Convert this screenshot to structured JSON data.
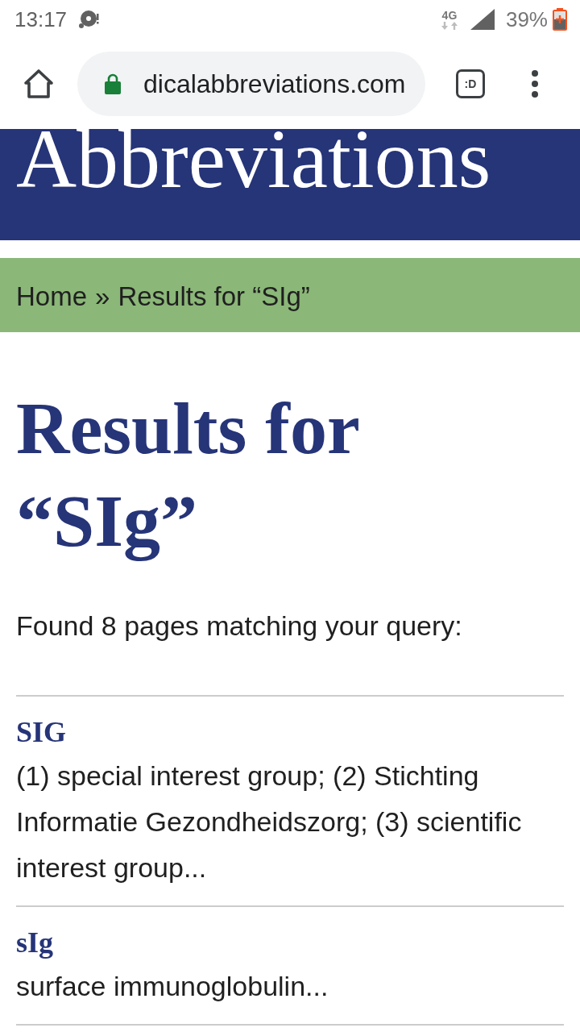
{
  "status_bar": {
    "time": "13:17",
    "network": "4G",
    "battery": "39%"
  },
  "browser": {
    "url": "dicalabbreviations.com",
    "tab_count": ":D"
  },
  "banner": {
    "title": "Abbreviations"
  },
  "breadcrumb": {
    "home": "Home",
    "separator": "»",
    "current": "Results for “SIg”"
  },
  "page": {
    "heading": "Results for “SIg”",
    "summary": "Found 8 pages matching your query:"
  },
  "results": [
    {
      "term": "SIG",
      "definition": "(1) special interest group; (2) Stichting Informatie Gezondheidszorg; (3) scientific interest group..."
    },
    {
      "term": "sIg",
      "definition": "surface immunoglobulin..."
    }
  ]
}
